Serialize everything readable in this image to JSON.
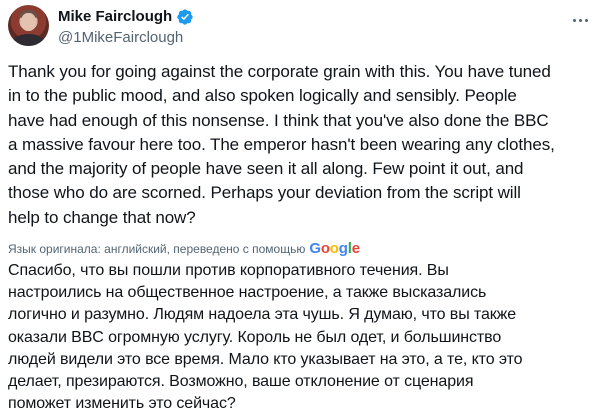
{
  "author": {
    "display_name": "Mike Fairclough",
    "handle": "@1MikeFairclough",
    "verified_icon": "verified-badge-icon",
    "avatar_icon": "avatar"
  },
  "colors": {
    "text_primary": "#0f1419",
    "text_secondary": "#536471",
    "verified_blue": "#1d9bf0"
  },
  "tweet": {
    "text_lines": [
      "Thank you for going against the corporate grain with this. You have tuned",
      "in to the public mood, and also spoken logically and sensibly. People",
      "have had enough of this nonsense. I think that you've also done the BBC",
      "a massive favour here too. The emperor hasn't been wearing any clothes,",
      "and the majority of people have seen it all along. Few point it out, and",
      "those who do are scorned. Perhaps your deviation from the script will",
      "help to change that now?"
    ]
  },
  "translation": {
    "attribution": "Язык оригинала: английский, переведено с помощью",
    "provider_letters": [
      "G",
      "o",
      "o",
      "g",
      "l",
      "e"
    ],
    "text_lines": [
      "Спасибо, что вы пошли против корпоративного течения. Вы",
      "настроились на общественное настроение, а также высказались",
      "логично и разумно. Людям надоела эта чушь. Я думаю, что вы также",
      "оказали BBC огромную услугу. Король не был одет, и большинство",
      "людей видели это все время. Мало кто указывает на это, а те, кто это",
      "делает, презираются. Возможно, ваше отклонение от сценария",
      "поможет изменить это сейчас?"
    ]
  }
}
